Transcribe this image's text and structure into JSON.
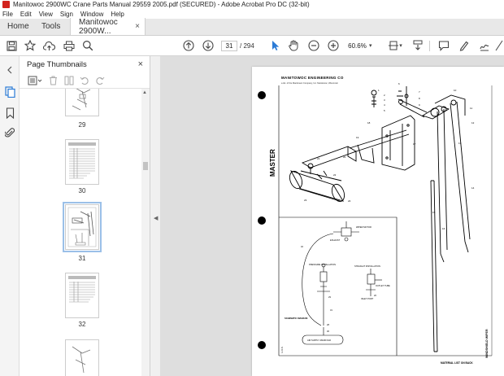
{
  "window": {
    "title": "Manitowoc 2900WC Crane Parts Manual 29559 2005.pdf (SECURED) - Adobe Acrobat Pro DC (32-bit)"
  },
  "menu": [
    "File",
    "Edit",
    "View",
    "Sign",
    "Window",
    "Help"
  ],
  "tabs": {
    "home": "Home",
    "tools": "Tools",
    "document": "Manitowoc 2900W...",
    "close": "×"
  },
  "toolbar": {
    "current_page": "31",
    "page_total": "/ 294",
    "zoom": "60.6%"
  },
  "panel": {
    "title": "Page Thumbnails",
    "close": "×",
    "thumbnails": [
      {
        "label": "29"
      },
      {
        "label": "30"
      },
      {
        "label": "31",
        "selected": true
      },
      {
        "label": "32"
      }
    ]
  },
  "document_page": {
    "header": "MANITOWOC ENGINEERING CO",
    "subheader": "a div. of the Manitowoc Company, Inc.          Manitowoc, Wisconsin",
    "vertical_label": "MASTER",
    "side_label": "WINDSHIELD WIPER",
    "footer_note": "MATERIAL LIST ON BACK",
    "inset_labels": {
      "schematic": "SCHEMATIC DIAGRAM",
      "pressure": "PRESSURE INSTALLATION",
      "straight": "STRAIGHT INSTALLATION",
      "wiper_motor": "WIPER MOTOR",
      "exhaust": "EXHAUST",
      "air_supply": "AIR SUPPLY MANIFOLD",
      "muffler_tube": "OUTLET TUBE",
      "inlet": "INLET PORT"
    },
    "part_numbers": [
      "1",
      "2",
      "3",
      "4",
      "5",
      "6",
      "7",
      "8",
      "9",
      "10",
      "11",
      "12",
      "13",
      "14",
      "15",
      "16",
      "17",
      "18",
      "19",
      "20",
      "21",
      "22",
      "23",
      "24",
      "25",
      "26",
      "27",
      "28",
      "29",
      "30",
      "31",
      "32"
    ]
  },
  "colors": {
    "acrobat_red": "#d2231d",
    "accent_blue": "#2b7bd6",
    "selection": "#9bc0e8"
  }
}
